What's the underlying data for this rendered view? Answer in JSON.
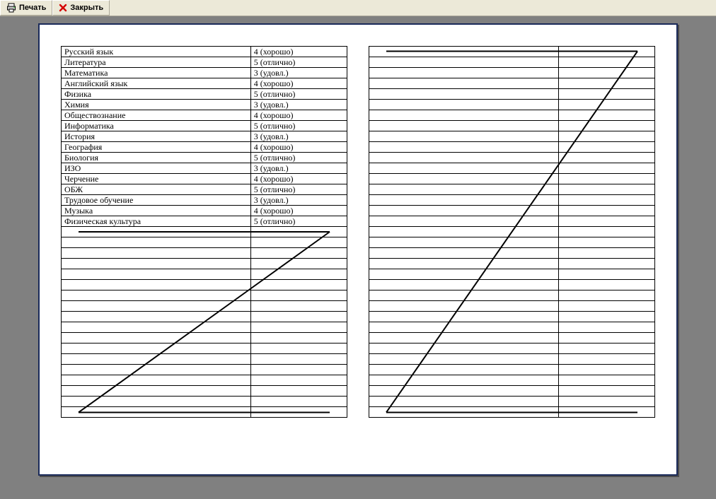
{
  "toolbar": {
    "print_label": "Печать",
    "close_label": "Закрыть"
  },
  "layout": {
    "left_total_rows": 35,
    "right_total_rows": 35
  },
  "grades": [
    {
      "subject": "Русский язык",
      "grade": "4 (хорошо)"
    },
    {
      "subject": "Литература",
      "grade": "5 (отлично)"
    },
    {
      "subject": "Математика",
      "grade": "3 (удовл.)"
    },
    {
      "subject": "Английский язык",
      "grade": "4 (хорошо)"
    },
    {
      "subject": "Физика",
      "grade": "5 (отлично)"
    },
    {
      "subject": "Химия",
      "grade": "3 (удовл.)"
    },
    {
      "subject": "Обществознание",
      "grade": "4 (хорошо)"
    },
    {
      "subject": "Информатика",
      "grade": "5 (отлично)"
    },
    {
      "subject": "История",
      "grade": "3 (удовл.)"
    },
    {
      "subject": "География",
      "grade": "4 (хорошо)"
    },
    {
      "subject": "Биология",
      "grade": "5 (отлично)"
    },
    {
      "subject": "ИЗО",
      "grade": "3 (удовл.)"
    },
    {
      "subject": "Черчение",
      "grade": "4 (хорошо)"
    },
    {
      "subject": "ОБЖ",
      "grade": "5 (отлично)"
    },
    {
      "subject": "Трудовое обучение",
      "grade": "3 (удовл.)"
    },
    {
      "subject": "Музыка",
      "grade": "4 (хорошо)"
    },
    {
      "subject": "Физическая культура",
      "grade": "5 (отлично)"
    }
  ]
}
